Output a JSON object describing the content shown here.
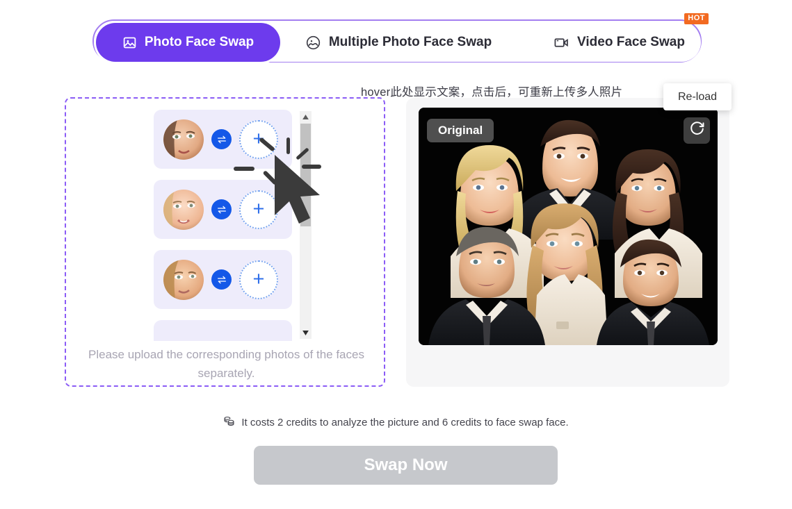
{
  "tabs": [
    {
      "label": "Photo Face Swap",
      "icon": "image-icon",
      "active": true,
      "badge": null
    },
    {
      "label": "Multiple Photo Face Swap",
      "icon": "circle-image-icon",
      "active": false,
      "badge": null
    },
    {
      "label": "Video Face Swap",
      "icon": "video-camera-icon",
      "active": false,
      "badge": "HOT"
    }
  ],
  "annotation": {
    "text": "hover此处显示文案，点击后，可重新上传多人照片"
  },
  "tooltip": {
    "label": "Re-load"
  },
  "left_panel": {
    "hint": "Please upload the corresponding photos of the faces separately.",
    "rows": [
      {
        "face_label": "face-1",
        "swap_icon": "swap-arrows-icon",
        "add_label": "+"
      },
      {
        "face_label": "face-2",
        "swap_icon": "swap-arrows-icon",
        "add_label": "+"
      },
      {
        "face_label": "face-3",
        "swap_icon": "swap-arrows-icon",
        "add_label": "+"
      },
      {
        "face_label": "face-4",
        "swap_icon": "swap-arrows-icon",
        "add_label": "+"
      }
    ]
  },
  "right_panel": {
    "badge": "Original",
    "reload_icon": "reload-icon"
  },
  "credits": {
    "icon": "coins-icon",
    "text": "It costs 2 credits to analyze the picture and 6 credits to face swap face."
  },
  "action": {
    "swap_label": "Swap Now",
    "enabled": false
  },
  "colors": {
    "accent_purple": "#6d3bed",
    "border_purple": "#8b5cf6",
    "swap_blue": "#1458e8",
    "hot_orange": "#f26a21",
    "disabled_gray": "#c6c8cc"
  }
}
